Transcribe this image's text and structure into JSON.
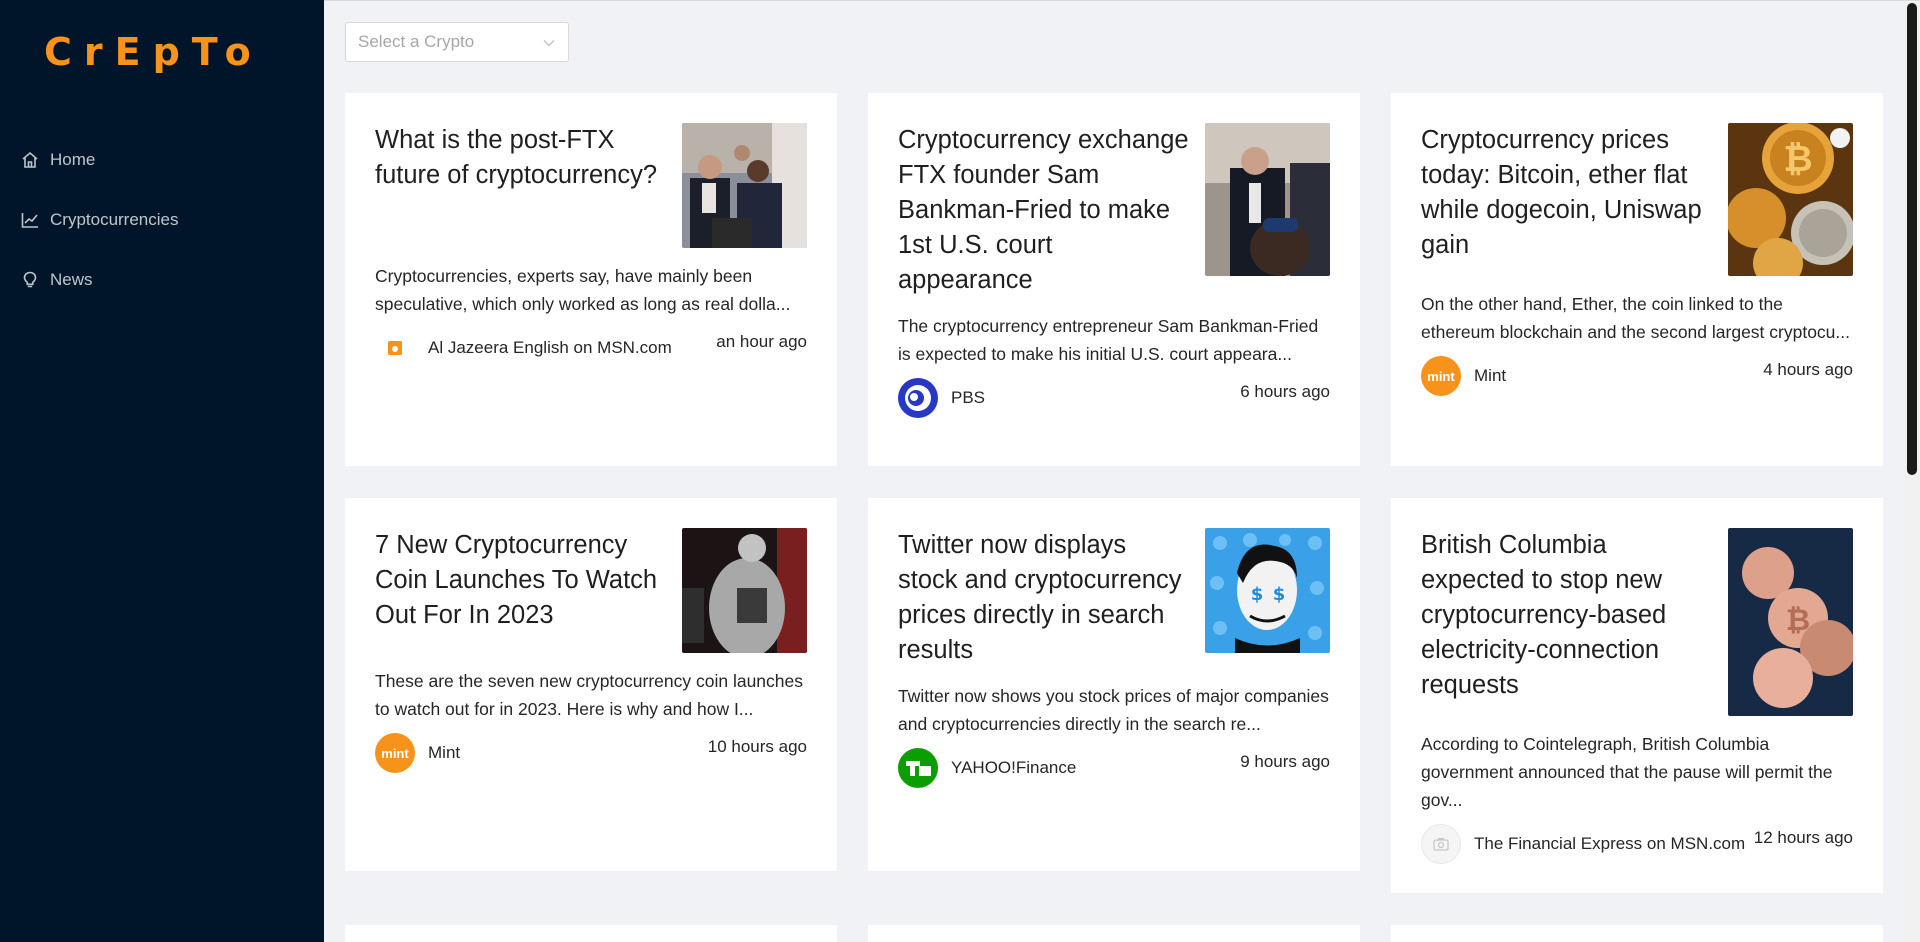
{
  "app": {
    "logo": "CrEpTo"
  },
  "sidebar": {
    "items": [
      {
        "label": "Home",
        "icon": "home-icon"
      },
      {
        "label": "Cryptocurrencies",
        "icon": "chart-icon"
      },
      {
        "label": "News",
        "icon": "bulb-icon"
      }
    ]
  },
  "filter": {
    "placeholder": "Select a Crypto"
  },
  "news": [
    {
      "title": "What is the post-FTX future of cryptocurrency?",
      "description": "Cryptocurrencies, experts say, have mainly been speculative, which only worked as long as real dolla...",
      "provider": "Al Jazeera English on MSN.com",
      "time": "an hour ago"
    },
    {
      "title": "Cryptocurrency exchange FTX founder Sam Bankman-Fried to make 1st U.S. court appearance",
      "description": "The cryptocurrency entrepreneur Sam Bankman-Fried is expected to make his initial U.S. court appeara...",
      "provider": "PBS",
      "time": "6 hours ago"
    },
    {
      "title": "Cryptocurrency prices today: Bitcoin, ether flat while dogecoin, Uniswap gain",
      "description": "On the other hand, Ether, the coin linked to the ethereum blockchain and the second largest cryptocu...",
      "provider": "Mint",
      "avatar_text": "mint",
      "time": "4 hours ago"
    },
    {
      "title": "7 New Cryptocurrency Coin Launches To Watch Out For In 2023",
      "description": "These are the seven new cryptocurrency coin launches to watch out for in 2023. Here is why and how I...",
      "provider": "Mint",
      "avatar_text": "mint",
      "time": "10 hours ago"
    },
    {
      "title": "Twitter now displays stock and cryptocurrency prices directly in search results",
      "description": "Twitter now shows you stock prices of major companies and cryptocurrencies directly in the search re...",
      "provider": "YAHOO!Finance",
      "time": "9 hours ago"
    },
    {
      "title": "British Columbia expected to stop new cryptocurrency-based electricity-connection requests",
      "description": "According to Cointelegraph, British Columbia government announced that the pause will permit the gov...",
      "provider": "The Financial Express on MSN.com",
      "time": "12 hours ago"
    }
  ],
  "colors": {
    "sidebar_bg": "#001529",
    "logo": "#f7931a",
    "page_bg": "#f0f2f5",
    "mint": "#f7931a",
    "pbs": "#2638c4",
    "techcrunch": "#0a9e01"
  }
}
